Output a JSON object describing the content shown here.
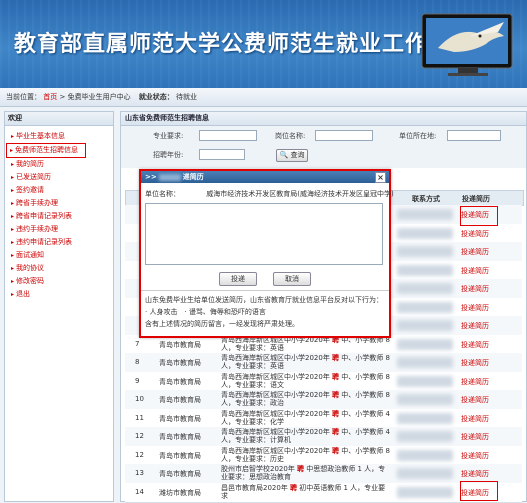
{
  "banner": {
    "title": "教育部直属师范大学公费师范生就业工作平台"
  },
  "breadcrumb": {
    "prefix": "当前位置：",
    "home": "首页",
    "sep1": " > ",
    "center": "免费毕业生用户中心",
    "status_label": "就业状态：",
    "status_value": "待就业"
  },
  "sidebar": {
    "title": "欢迎",
    "items": [
      {
        "label": "毕业生基本信息"
      },
      {
        "label": "免费师范生招聘信息"
      },
      {
        "label": "我的简历"
      },
      {
        "label": "已发送简历"
      },
      {
        "label": "签约邀请"
      },
      {
        "label": "跨省手续办理"
      },
      {
        "label": "跨省申请记录列表"
      },
      {
        "label": "违约手续办理"
      },
      {
        "label": "违约申请记录列表"
      },
      {
        "label": "面试通知"
      },
      {
        "label": "我的协议"
      },
      {
        "label": "修改密码"
      },
      {
        "label": "退出"
      }
    ]
  },
  "main": {
    "title": "山东省免费师范生招聘信息",
    "search": {
      "major_label": "专业要求:",
      "position_label": "岗位名称:",
      "location_label": "单位所在地:",
      "year_label": "招聘年份:",
      "query_label": "查询"
    },
    "table": {
      "headers": {
        "contact": "联系方式",
        "action": "投递简历"
      },
      "rows": [
        {
          "no": "",
          "unit": "",
          "post_pre": "",
          "post_kw": "",
          "post_post": "",
          "action": "投递简历"
        },
        {
          "no": "",
          "unit": "",
          "post_pre": "",
          "post_kw": "",
          "post_post": "",
          "action": "投递简历"
        },
        {
          "no": "",
          "unit": "",
          "post_pre": "",
          "post_kw": "",
          "post_post": "",
          "action": "投递简历"
        },
        {
          "no": "",
          "unit": "",
          "post_pre": "",
          "post_kw": "",
          "post_post": "",
          "action": "投递简历"
        },
        {
          "no": "",
          "unit": "",
          "post_pre": "",
          "post_kw": "",
          "post_post": "",
          "action": "投递简历"
        },
        {
          "no": "",
          "unit": "",
          "post_pre": "",
          "post_kw": "",
          "post_post": "",
          "action": "投递简历"
        },
        {
          "no": "",
          "unit": "",
          "post_pre": "",
          "post_kw": "",
          "post_post": "",
          "action": "投递简历"
        },
        {
          "no": "7",
          "unit": "青岛市教育局",
          "post_pre": "青岛西海岸新区城区中小学2020年 ",
          "post_kw": "聘",
          "post_post": " 中、小学教师 8 人，专业要求：英语",
          "action": "投递简历"
        },
        {
          "no": "8",
          "unit": "青岛市教育局",
          "post_pre": "青岛西海岸新区城区中小学2020年 ",
          "post_kw": "聘",
          "post_post": " 中、小学教师 8 人，专业要求：英语",
          "action": "投递简历"
        },
        {
          "no": "9",
          "unit": "青岛市教育局",
          "post_pre": "青岛西海岸新区城区中小学2020年 ",
          "post_kw": "聘",
          "post_post": " 中、小学教师 8 人，专业要求：语文",
          "action": "投递简历"
        },
        {
          "no": "10",
          "unit": "青岛市教育局",
          "post_pre": "青岛西海岸新区城区中小学2020年 ",
          "post_kw": "聘",
          "post_post": " 中、小学教师 8 人，专业要求：政治",
          "action": "投递简历"
        },
        {
          "no": "11",
          "unit": "青岛市教育局",
          "post_pre": "青岛西海岸新区城区中小学2020年 ",
          "post_kw": "聘",
          "post_post": " 中、小学教师 4 人，专业要求：化学",
          "action": "投递简历"
        },
        {
          "no": "12",
          "unit": "青岛市教育局",
          "post_pre": "青岛西海岸新区城区中小学2020年 ",
          "post_kw": "聘",
          "post_post": " 中、小学教师 4 人，专业要求：计算机",
          "action": "投递简历"
        },
        {
          "no": "12",
          "unit": "青岛市教育局",
          "post_pre": "青岛西海岸新区城区中小学2020年 ",
          "post_kw": "聘",
          "post_post": " 中、小学教师 8 人，专业要求：历史",
          "action": "投递简历"
        },
        {
          "no": "13",
          "unit": "青岛市教育局",
          "post_pre": "胶州市启智学校2020年 ",
          "post_kw": "聘",
          "post_post": " 中思想政治教师 1 人，专业要求：思想政治教育",
          "action": "投递简历"
        },
        {
          "no": "14",
          "unit": "潍坊市教育局",
          "post_pre": "昌邑市教育局2020年 ",
          "post_kw": "聘",
          "post_post": " 初中英语教师 1 人，专业要求",
          "action": "投递简历"
        }
      ]
    }
  },
  "modal": {
    "title_prefix": ">>",
    "title": "递简历",
    "close": "×",
    "unit_label": "单位名称：",
    "unit_value": "威海市经济技术开发区教育局(威海经济技术开发区皇冠中学)",
    "submit_label": "投递",
    "cancel_label": "取消",
    "note1": "山东免费毕业生给单位发送简历，山东省教育厅就业信息平台反对以下行为：",
    "note2": "· 人身攻击　· 谩骂、侮辱和恐吓的语言",
    "note3": "含有上述情况的简历留言，一经发现将严肃处理。"
  }
}
